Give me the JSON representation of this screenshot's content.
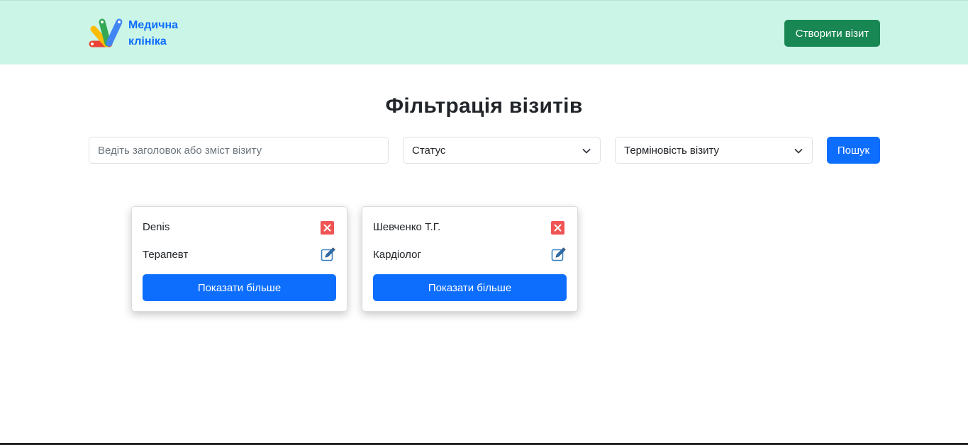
{
  "header": {
    "brand_line1": "Медична",
    "brand_line2": "клініка",
    "create_visit_label": "Створити візит",
    "background_color": "#cbf5e7"
  },
  "filters": {
    "title": "Фільтрація візитів",
    "search_placeholder": "Ведіть заголовок або зміст візиту",
    "status_selected": "Статус",
    "urgency_selected": "Терміновість візиту",
    "search_label": "Пошук"
  },
  "cards": [
    {
      "name": "Denis",
      "doctor": "Терапевт",
      "more_label": "Показати більше",
      "delete_icon": "close-icon",
      "edit_icon": "edit-icon"
    },
    {
      "name": "Шевченко Т.Г.",
      "doctor": "Кардіолог",
      "more_label": "Показати більше",
      "delete_icon": "close-icon",
      "edit_icon": "edit-icon"
    }
  ],
  "colors": {
    "primary": "#0d6efd",
    "success": "#198754",
    "danger": "#f05454"
  }
}
